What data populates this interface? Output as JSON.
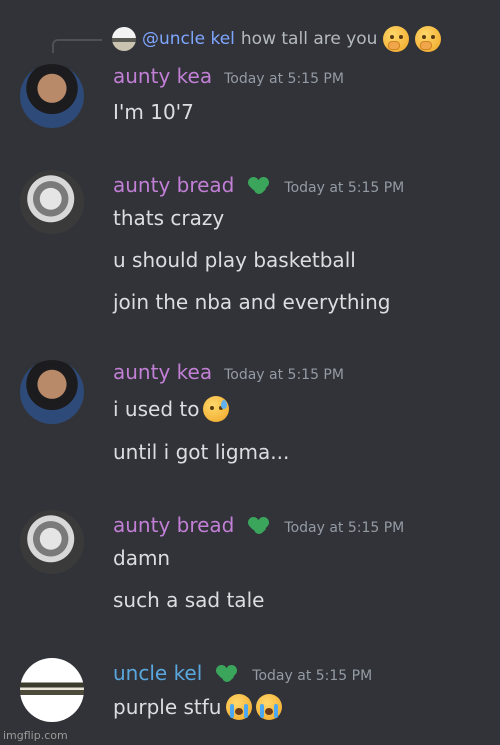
{
  "reply": {
    "mention": "@uncle kel",
    "text": "how tall are you",
    "emojis": [
      "thinking-face",
      "thinking-face"
    ]
  },
  "messages": [
    {
      "author": "aunty kea",
      "author_color": "#c27fd6",
      "timestamp": "Today at 5:15 PM",
      "has_role_icon": false,
      "lines": [
        "I'm 10'7"
      ]
    },
    {
      "author": "aunty bread",
      "author_color": "#c27fd6",
      "timestamp": "Today at 5:15 PM",
      "has_role_icon": true,
      "lines": [
        "thats crazy",
        "u should play basketball",
        "join the nba and everything"
      ]
    },
    {
      "author": "aunty kea",
      "author_color": "#c27fd6",
      "timestamp": "Today at 5:15 PM",
      "has_role_icon": false,
      "lines": [
        "i used to",
        "until i got ligma..."
      ],
      "line_emojis": [
        "sad-but-relieved-face",
        ""
      ]
    },
    {
      "author": "aunty bread",
      "author_color": "#c27fd6",
      "timestamp": "Today at 5:15 PM",
      "has_role_icon": true,
      "lines": [
        "damn",
        "such a sad tale"
      ]
    },
    {
      "author": "uncle kel",
      "author_color": "#5aa7de",
      "timestamp": "Today at 5:15 PM",
      "has_role_icon": true,
      "lines": [
        "purple stfu"
      ],
      "line_emojis": [
        "loudly-crying-face"
      ]
    }
  ],
  "watermark": "imgflip.com",
  "colors": {
    "background": "#313338",
    "role_icon": "#3ba55c",
    "mention": "#7fa6ff"
  }
}
